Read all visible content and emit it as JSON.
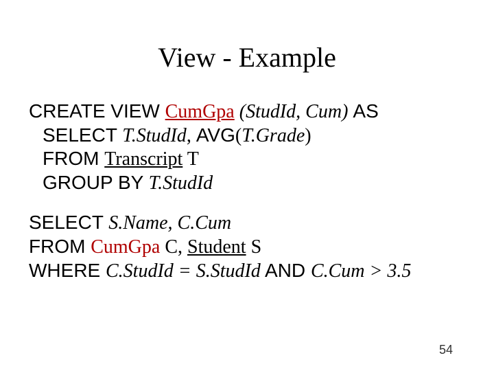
{
  "title": "View - Example",
  "block1": {
    "kw_create_view": "CREATE VIEW  ",
    "view_name": "CumGpa",
    "args_open": " (",
    "arg1": "StudId",
    "arg_sep": ", ",
    "arg2": "Cum",
    "args_close": ") ",
    "kw_as": "AS",
    "kw_select": "SELECT  ",
    "sel_col1": "T.StudId",
    "sel_sep": ",  ",
    "kw_avg": "AVG",
    "avg_open": "(",
    "avg_arg": "T.Grade",
    "avg_close": ")",
    "kw_from": "FROM ",
    "from_table": "Transcript",
    "from_alias": " T",
    "kw_group_by": "GROUP BY ",
    "group_col": "T.StudId"
  },
  "block2": {
    "kw_select": "SELECT  ",
    "col1": "S.Name",
    "sep1": ", ",
    "col2": "C.Cum",
    "kw_from": "FROM  ",
    "from_v": "CumGpa",
    "from_v_alias": " C,  ",
    "from_t": "Student",
    "from_t_alias": " S",
    "kw_where": "WHERE  ",
    "cond_l": "C.StudId",
    "cond_eq": " = ",
    "cond_r": "S.StudId",
    "kw_and": " AND ",
    "cond2_l": "C.Cum",
    "cond2_op": " > ",
    "cond2_r": "3.5"
  },
  "page_number": "54"
}
